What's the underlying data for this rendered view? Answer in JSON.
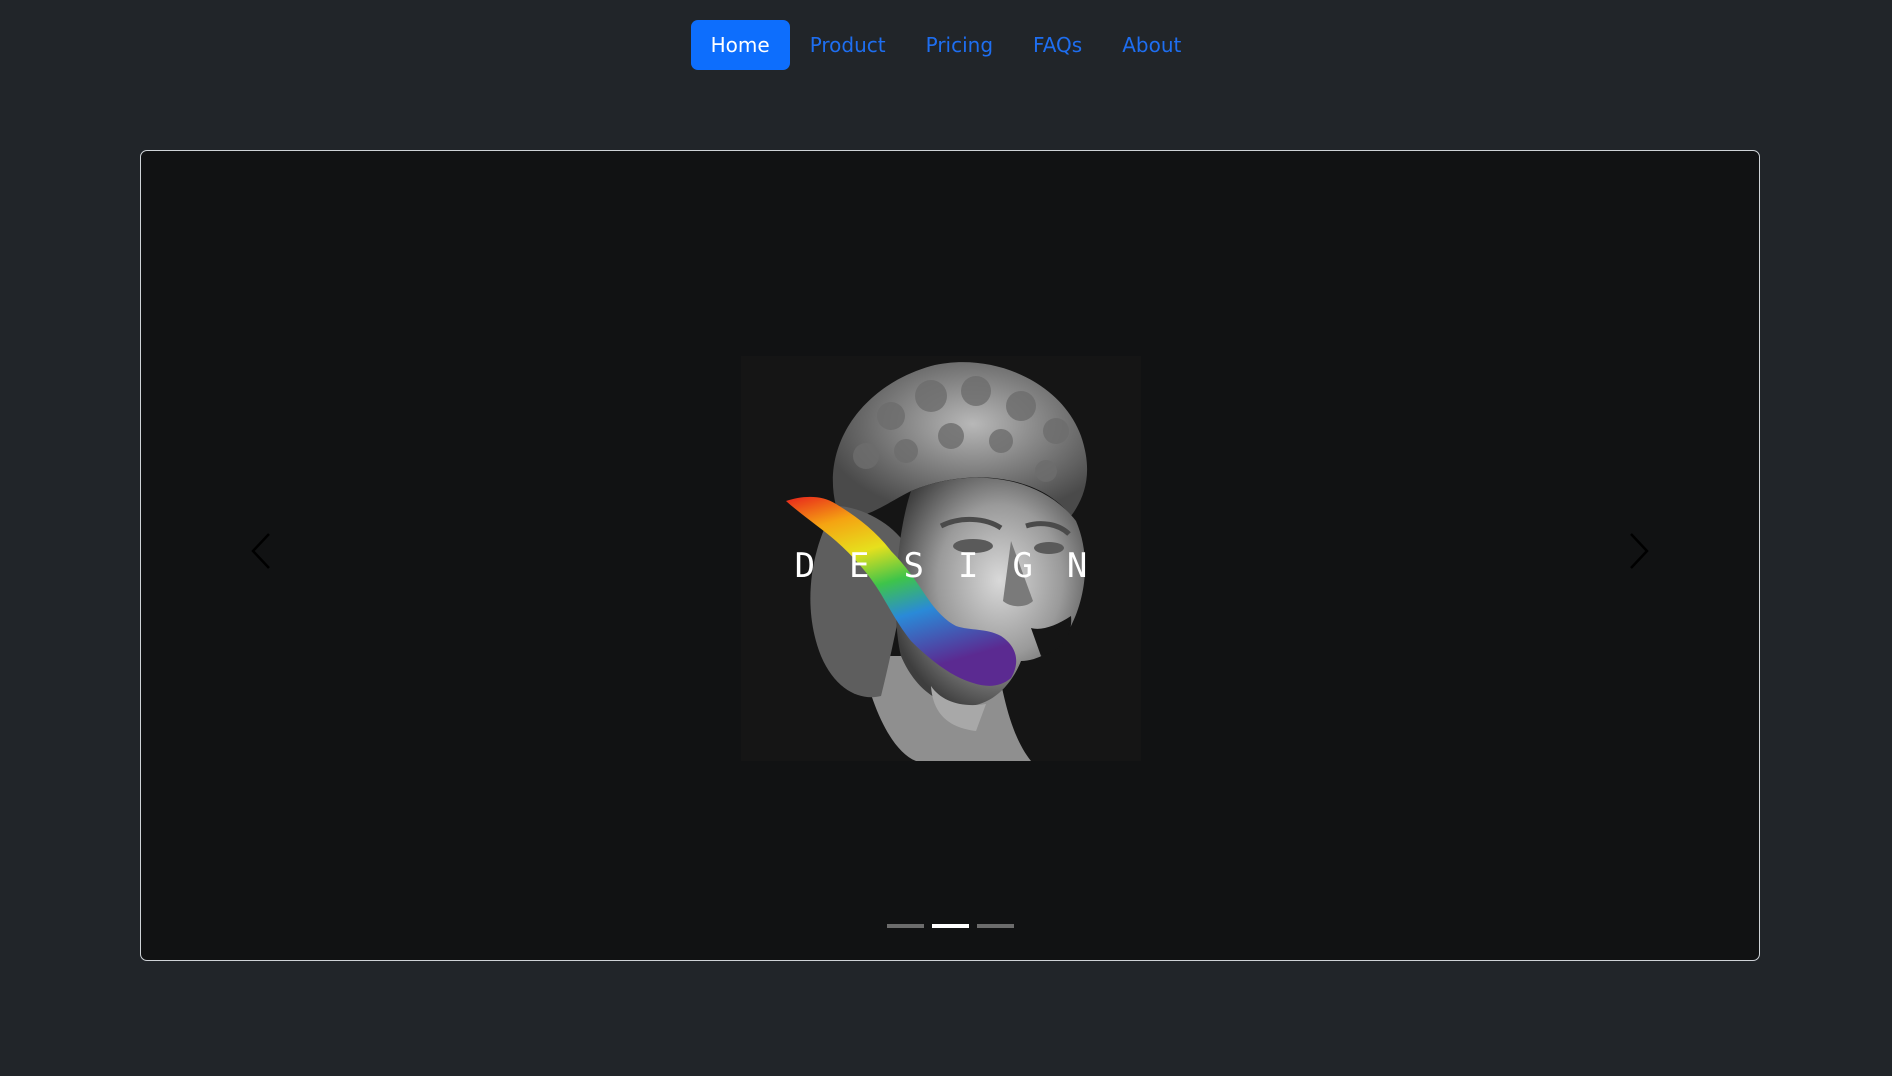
{
  "nav": {
    "items": [
      {
        "label": "Home",
        "active": true
      },
      {
        "label": "Product"
      },
      {
        "label": "Pricing"
      },
      {
        "label": "FAQs"
      },
      {
        "label": "About"
      }
    ]
  },
  "carousel": {
    "active_slide": 2,
    "slide_count": 3,
    "caption": "DESIGN",
    "prev_icon": "chevron-left-icon",
    "next_icon": "chevron-right-icon"
  },
  "colors": {
    "page_bg": "#212529",
    "accent": "#0d6efd",
    "link": "#1e6ef0",
    "carousel_bg": "#111213"
  }
}
